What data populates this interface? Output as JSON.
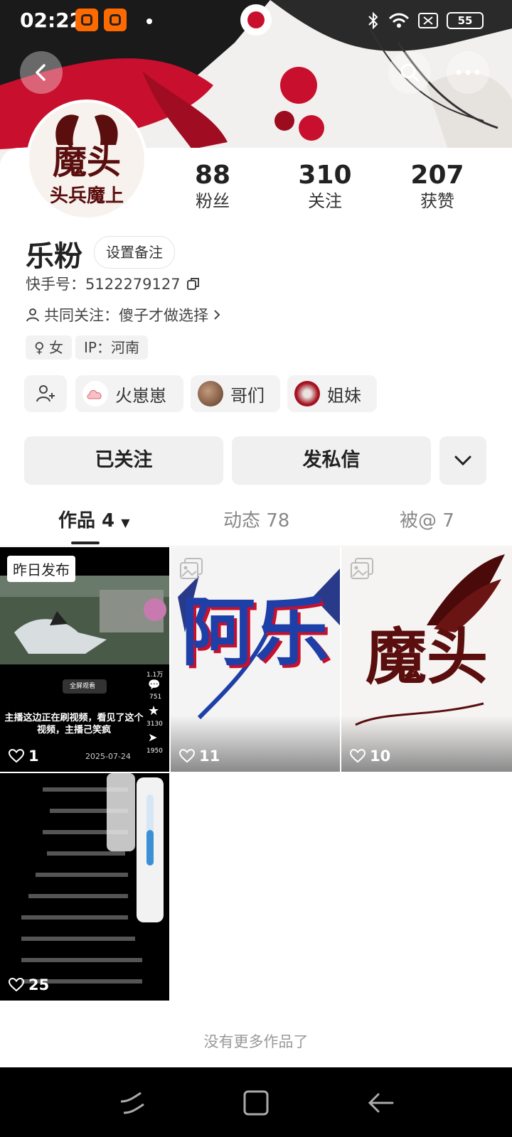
{
  "status": {
    "time": "02:22",
    "battery": "55"
  },
  "profile": {
    "followers": {
      "value": "88",
      "label": "粉丝"
    },
    "following": {
      "value": "310",
      "label": "关注"
    },
    "likes": {
      "value": "207",
      "label": "获赞"
    },
    "name": "乐粉",
    "remark_button": "设置备注",
    "kuaishou_id": "快手号：5122279127",
    "mutual_follow": "共同关注：傻子才做选择",
    "gender_tag": "女",
    "ip_tag": "IP：河南"
  },
  "friend_chips": [
    {
      "label": "火崽崽"
    },
    {
      "label": "哥们"
    },
    {
      "label": "姐妹"
    }
  ],
  "actions": {
    "followed": "已关注",
    "message": "发私信"
  },
  "tabs": [
    {
      "label": "作品 4"
    },
    {
      "label": "动态 78"
    },
    {
      "label": "被@ 7"
    }
  ],
  "works": [
    {
      "likes": "1",
      "badge": "昨日发布",
      "overlay_text": "主播这边正在刷视频，看见了这个视频，主播己笑疯",
      "date": "2025-07-24",
      "side_counts": [
        "1.1万",
        "751",
        "3130",
        "1950"
      ],
      "fullscreen_label": "全屏观看"
    },
    {
      "likes": "11",
      "art_text": "阿乐"
    },
    {
      "likes": "10",
      "art_text": "魔头"
    },
    {
      "likes": "25"
    }
  ],
  "avatar_text": {
    "main": "魔头",
    "sub": "头兵魔上"
  },
  "footer": "没有更多作品了",
  "colors": {
    "accent_red": "#c8102e",
    "dark_red": "#5a0e0e",
    "blue": "#1f3fa8"
  }
}
